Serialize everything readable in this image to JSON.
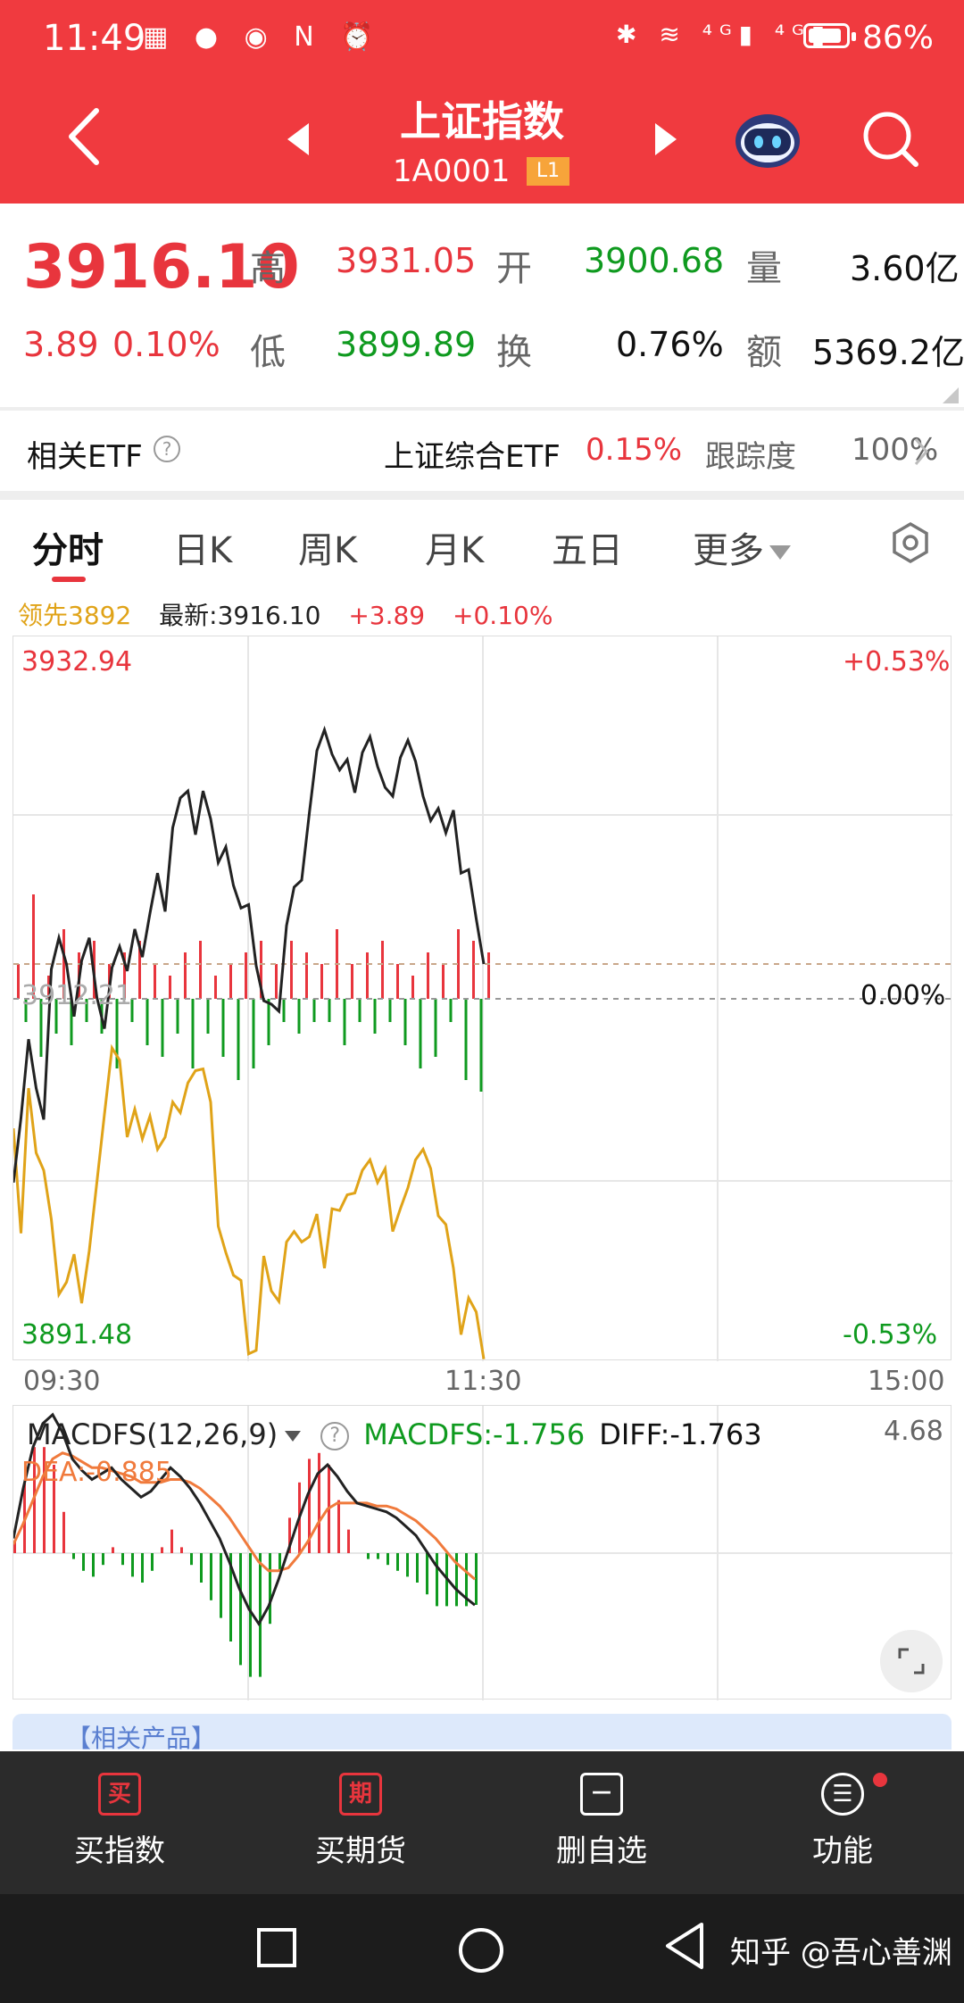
{
  "status_bar": {
    "time": "11:49",
    "left_icons": "▦ ● ◉ N ⏰",
    "right_icons": "✱ ≋ ⁴ᴳ▮ ⁴ᴳ▮",
    "battery": "86%"
  },
  "header": {
    "title": "上证指数",
    "code": "1A0001",
    "badge": "L1"
  },
  "quote": {
    "price": "3916.10",
    "change": "3.89",
    "change_pct": "0.10%",
    "high_label": "高",
    "high": "3931.05",
    "open_label": "开",
    "open": "3900.68",
    "volume_label": "量",
    "volume": "3.60亿",
    "low_label": "低",
    "low": "3899.89",
    "turnover_label": "换",
    "turnover": "0.76%",
    "amount_label": "额",
    "amount": "5369.2亿"
  },
  "etf": {
    "label": "相关ETF",
    "name": "上证综合ETF",
    "change": "0.15%",
    "tracking_label": "跟踪度",
    "tracking": "100%"
  },
  "tabs": [
    "分时",
    "日K",
    "周K",
    "月K",
    "五日",
    "更多"
  ],
  "info": {
    "leader": "领先3892",
    "latest": "最新:3916.10",
    "change": "+3.89",
    "change_pct": "+0.10%"
  },
  "chart_data": {
    "type": "line",
    "y_max": "3932.94",
    "y_min": "3891.48",
    "pct_max": "+0.53%",
    "pct_min": "-0.53%",
    "pct_mid": "0.00%",
    "prev_close_label": "3912.21",
    "ylim": [
      3891.48,
      3932.94
    ],
    "prev_close": 3912.21,
    "time_labels": [
      "09:30",
      "11:30",
      "15:00"
    ],
    "price": [
      3901.7,
      3905.4,
      3909.9,
      3907.1,
      3905.3,
      3913.9,
      3915.7,
      3914.2,
      3911.2,
      3914.4,
      3915.7,
      3912.3,
      3910.5,
      3914.0,
      3915.2,
      3913.8,
      3916.2,
      3914.6,
      3917.1,
      3919.4,
      3917.2,
      3922.0,
      3923.7,
      3924.1,
      3921.6,
      3924.1,
      3922.5,
      3920.0,
      3920.9,
      3918.7,
      3917.4,
      3917.6,
      3914.1,
      3912.1,
      3911.9,
      3911.5,
      3916.4,
      3918.6,
      3919.0,
      3922.8,
      3926.4,
      3927.6,
      3926.2,
      3925.3,
      3925.9,
      3924.0,
      3926.3,
      3927.2,
      3925.5,
      3924.3,
      3923.8,
      3926.0,
      3927.0,
      3925.8,
      3923.8,
      3922.4,
      3923.1,
      3921.7,
      3923.0,
      3919.4,
      3919.6,
      3916.8,
      3914.2
    ],
    "leader": [
      3904.8,
      3898.8,
      3907.1,
      3903.4,
      3902.4,
      3899.6,
      3895.3,
      3896.0,
      3897.6,
      3894.8,
      3897.8,
      3901.7,
      3905.6,
      3909.4,
      3908.7,
      3904.3,
      3905.9,
      3904.2,
      3905.5,
      3903.6,
      3904.3,
      3906.3,
      3905.7,
      3907.4,
      3908.1,
      3908.2,
      3906.3,
      3899.2,
      3897.7,
      3896.4,
      3896.1,
      3891.9,
      3892.1,
      3897.5,
      3895.5,
      3894.9,
      3898.3,
      3898.9,
      3898.3,
      3898.6,
      3899.9,
      3896.8,
      3900.2,
      3900.1,
      3901.0,
      3901.1,
      3902.4,
      3903.0,
      3901.7,
      3902.5,
      3898.9,
      3900.2,
      3901.4,
      3903.0,
      3903.6,
      3902.5,
      3899.8,
      3899.3,
      3896.8,
      3893.0,
      3895.1,
      3894.3,
      3891.6
    ],
    "volume": [
      0.3,
      -0.2,
      0.9,
      -0.5,
      0.2,
      -0.3,
      0.6,
      -0.4,
      0.4,
      -0.2,
      0.5,
      -0.3,
      0.3,
      -0.6,
      0.4,
      -0.2,
      0.5,
      -0.4,
      0.3,
      -0.5,
      0.2,
      -0.3,
      0.4,
      -0.6,
      0.5,
      -0.3,
      0.2,
      -0.5,
      0.3,
      -0.7,
      0.4,
      -0.6,
      0.5,
      -0.4,
      0.3,
      -0.2,
      0.5,
      -0.3,
      0.4,
      -0.2,
      0.3,
      -0.2,
      0.6,
      -0.4,
      0.3,
      -0.2,
      0.4,
      -0.3,
      0.5,
      -0.2,
      0.3,
      -0.4,
      0.2,
      -0.6,
      0.4,
      -0.5,
      0.3,
      -0.2,
      0.6,
      -0.7,
      0.5,
      -0.8,
      0.4
    ]
  },
  "macd": {
    "name": "MACDFS(12,26,9)",
    "macdfs": "MACDFS:-1.756",
    "diff": "DIFF:-1.763",
    "dea": "DEA:-0.885",
    "max": "4.68",
    "diff_series": [
      0.5,
      2.2,
      3.6,
      4.4,
      4.7,
      4.1,
      3.2,
      2.8,
      2.5,
      2.7,
      2.9,
      2.5,
      2.2,
      1.9,
      2.1,
      2.5,
      2.9,
      2.6,
      2.2,
      1.7,
      1.1,
      0.5,
      -0.3,
      -1.2,
      -1.9,
      -2.4,
      -1.8,
      -0.9,
      0.1,
      1.1,
      2.0,
      2.7,
      3.0,
      2.6,
      2.1,
      1.7,
      1.6,
      1.5,
      1.4,
      1.2,
      0.9,
      0.6,
      0.1,
      -0.4,
      -0.8,
      -1.2,
      -1.5,
      -1.763
    ],
    "dea_series": [
      0.3,
      1.0,
      1.8,
      2.6,
      3.2,
      3.4,
      3.3,
      3.1,
      2.9,
      2.9,
      2.8,
      2.7,
      2.6,
      2.4,
      2.4,
      2.4,
      2.5,
      2.5,
      2.4,
      2.2,
      1.9,
      1.6,
      1.2,
      0.7,
      0.2,
      -0.3,
      -0.6,
      -0.6,
      -0.5,
      -0.1,
      0.4,
      1.0,
      1.5,
      1.7,
      1.7,
      1.7,
      1.7,
      1.6,
      1.6,
      1.5,
      1.3,
      1.1,
      0.8,
      0.5,
      0.1,
      -0.3,
      -0.6,
      -0.885
    ],
    "hist_series": [
      0.4,
      2.4,
      3.6,
      3.6,
      3.0,
      1.4,
      -0.2,
      -0.6,
      -0.8,
      -0.4,
      0.2,
      -0.4,
      -0.8,
      -1.0,
      -0.6,
      0.2,
      0.8,
      0.2,
      -0.4,
      -1.0,
      -1.6,
      -2.2,
      -3.0,
      -3.8,
      -4.2,
      -4.2,
      -2.4,
      -0.6,
      1.2,
      2.4,
      3.2,
      3.4,
      3.0,
      1.8,
      0.8,
      0.0,
      -0.2,
      -0.2,
      -0.4,
      -0.6,
      -0.8,
      -1.0,
      -1.4,
      -1.8,
      -1.8,
      -1.8,
      -1.8,
      -1.756
    ]
  },
  "banner": "【相关产品】",
  "bottom_nav": [
    {
      "icon": "买",
      "label": "买指数"
    },
    {
      "icon": "期",
      "label": "买期货"
    },
    {
      "icon": "－",
      "label": "删自选"
    },
    {
      "icon": "☰",
      "label": "功能"
    }
  ],
  "watermark": "知乎 @吾心善渊",
  "colors": {
    "up": "#e8353d",
    "down": "#0f9a1f",
    "price_line": "#222222",
    "leader_line": "#e0a318",
    "dea_line": "#f07a3c",
    "header": "#f03a3f"
  }
}
